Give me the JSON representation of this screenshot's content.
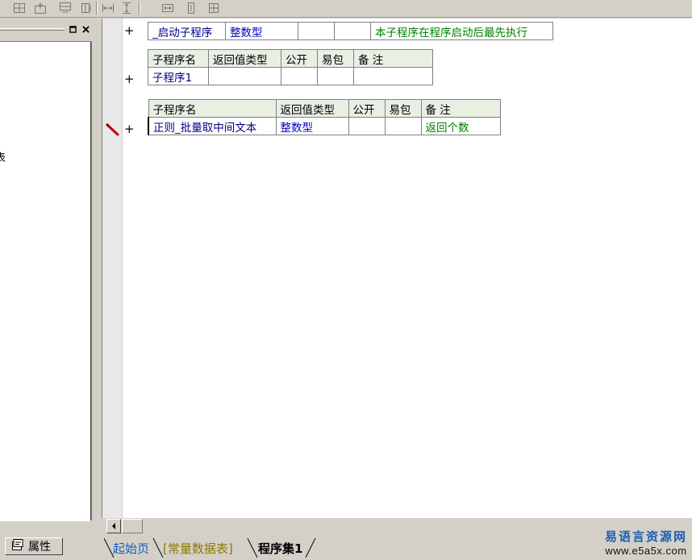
{
  "toolbar": {
    "icons": [
      "table-insert-row-icon",
      "table-insert-above-icon",
      "table-insert-below-icon",
      "table-split-icon",
      "fit-width-icon",
      "fit-height-icon",
      "align-horizontal-icon",
      "align-vertical-icon",
      "center-icon"
    ]
  },
  "left_panel": {
    "tree_fragment": "表",
    "property_tab_label": "属性"
  },
  "editor": {
    "startup_row": {
      "name": "_启动子程序",
      "return_type": "整数型",
      "public": "",
      "easy_pkg": "",
      "note": "本子程序在程序启动后最先执行"
    },
    "sub1": {
      "headers": [
        "子程序名",
        "返回值类型",
        "公开",
        "易包",
        "备 注"
      ],
      "row": {
        "name": "子程序1",
        "return_type": "",
        "public": "",
        "easy_pkg": "",
        "note": ""
      }
    },
    "sub2": {
      "headers": [
        "子程序名",
        "返回值类型",
        "公开",
        "易包",
        "备 注"
      ],
      "row": {
        "name": "正则_批量取中间文本",
        "return_type": "整数型",
        "public": "",
        "easy_pkg": "",
        "note": "返回个数"
      }
    },
    "plus_symbol": "+"
  },
  "tabs": {
    "start_page": "起始页",
    "const_table": "[常量数据表]",
    "program_set": "程序集1"
  },
  "watermark": {
    "cn": "易语言资源网",
    "url": "www.e5a5x.com"
  },
  "colors": {
    "name": "#00008b",
    "type": "#0000c0",
    "note": "#008000",
    "header_bg": "#e8f0e4"
  }
}
